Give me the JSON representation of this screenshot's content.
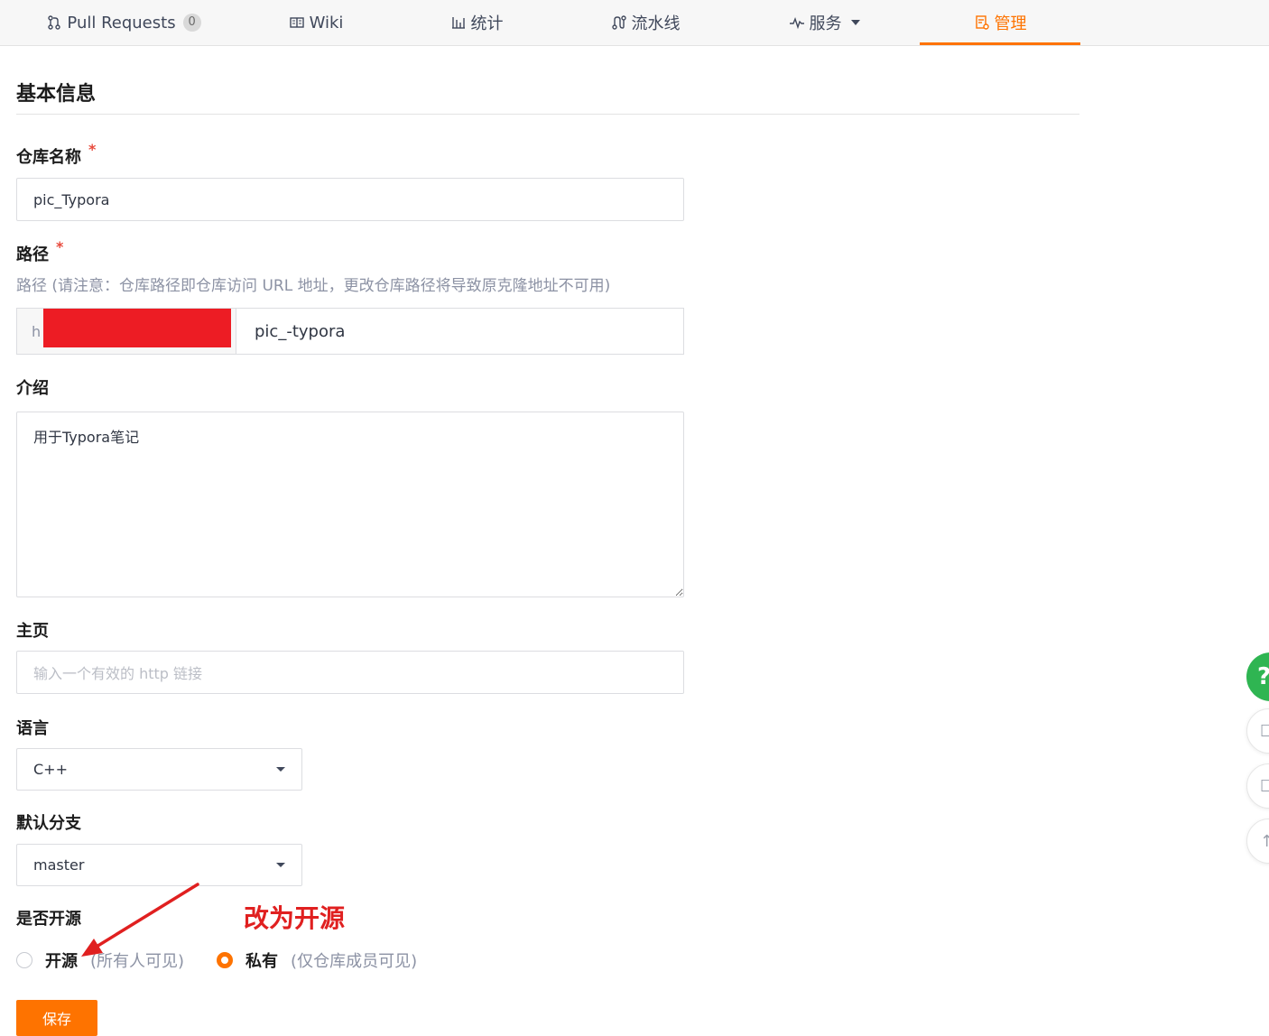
{
  "nav": {
    "tabs": [
      {
        "label": "Pull Requests",
        "badge": "0",
        "icon": "pull-request-icon"
      },
      {
        "label": "Wiki",
        "icon": "wiki-book-icon"
      },
      {
        "label": "统计",
        "icon": "bar-chart-icon"
      },
      {
        "label": "流水线",
        "icon": "pipeline-icon"
      },
      {
        "label": "服务",
        "icon": "pulse-icon"
      },
      {
        "label": "管理",
        "icon": "manage-icon"
      }
    ],
    "active_tab": "管理"
  },
  "form": {
    "section_title": "基本信息",
    "repo_name": {
      "label": "仓库名称",
      "required_mark": "*",
      "value": "pic_Typora"
    },
    "path": {
      "label": "路径",
      "required_mark": "*",
      "hint": "路径 (请注意：仓库路径即仓库访问 URL 地址，更改仓库路径将导致原克隆地址不可用)",
      "prefix_visible": "h",
      "value": "pic_-typora"
    },
    "intro": {
      "label": "介绍",
      "value": "用于Typora笔记"
    },
    "homepage": {
      "label": "主页",
      "placeholder": "输入一个有效的 http 链接"
    },
    "language": {
      "label": "语言",
      "selected": "C++"
    },
    "default_branch": {
      "label": "默认分支",
      "selected": "master"
    },
    "open_source": {
      "label": "是否开源",
      "options": [
        {
          "label": "开源",
          "desc": "(所有人可见)",
          "selected": false
        },
        {
          "label": "私有",
          "desc": "(仅仓库成员可见)",
          "selected": true
        }
      ]
    },
    "save_label": "保存"
  },
  "annotation": {
    "text": "改为开源",
    "color": "#e02020"
  },
  "colors": {
    "accent": "#fe7300",
    "help_green": "#2fb552",
    "redaction": "#ed1c24"
  },
  "floating": {
    "help_label": "?"
  }
}
